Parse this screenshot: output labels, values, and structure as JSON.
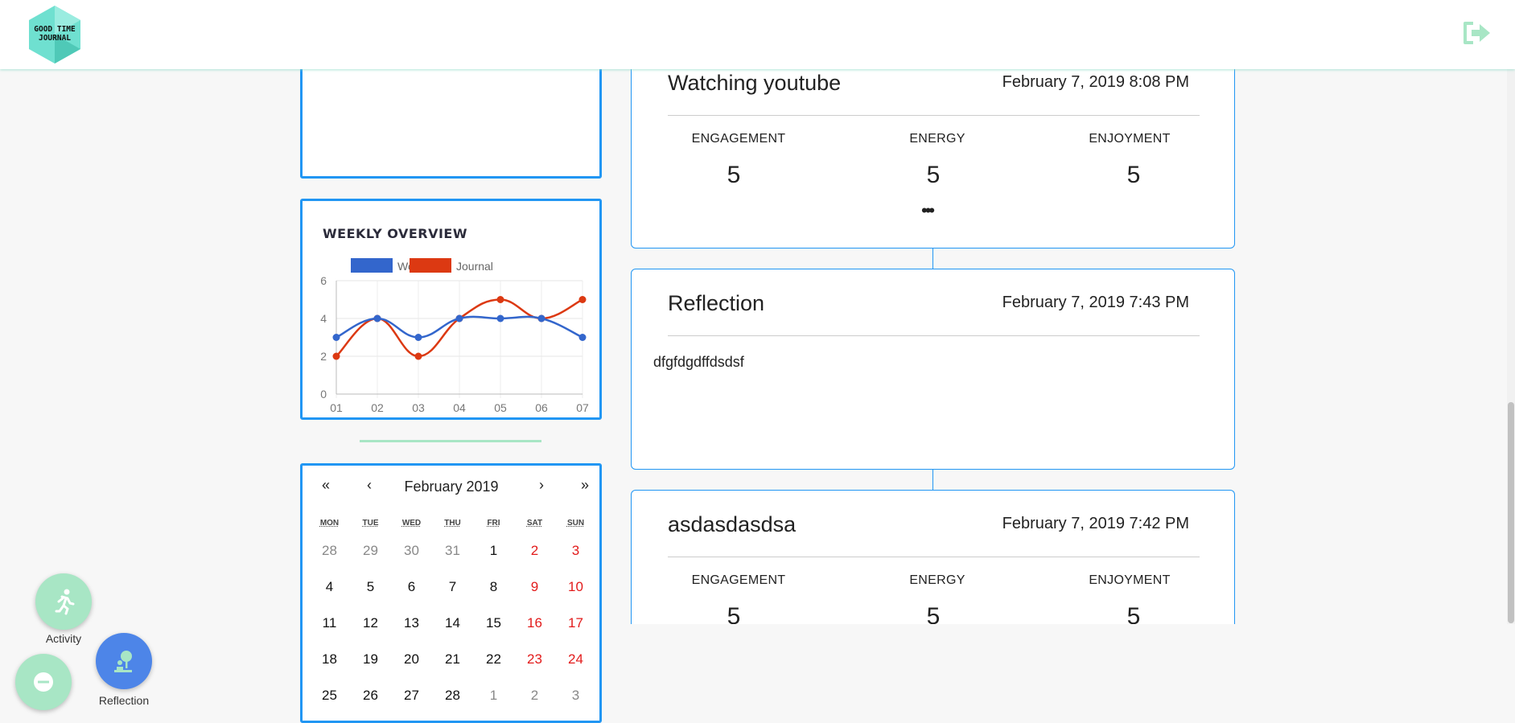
{
  "header": {
    "logo_text_line1": "GOOD TIME",
    "logo_text_line2": "JOURNAL",
    "logout_icon": "sign-out-icon"
  },
  "chart_panel": {
    "chart_data": {
      "type": "line",
      "title": "WEEKLY OVERVIEW",
      "categories": [
        "01",
        "02",
        "03",
        "04",
        "05",
        "06",
        "07"
      ],
      "series": [
        {
          "name": "Workout",
          "values": [
            3,
            4,
            3,
            4,
            4,
            4,
            3
          ],
          "color": "#3366cc"
        },
        {
          "name": "Journal",
          "values": [
            2,
            4,
            2,
            4,
            5,
            4,
            5
          ],
          "color": "#dc3912"
        }
      ],
      "ylim": [
        0,
        6
      ],
      "yticks": [
        0,
        2,
        4,
        6
      ],
      "grid": true,
      "legend": "top"
    }
  },
  "calendar": {
    "prev_year": "«",
    "prev_month": "‹",
    "month_label": "February 2019",
    "next_month": "›",
    "next_year": "»",
    "weekdays": [
      "MON",
      "TUE",
      "WED",
      "THU",
      "FRI",
      "SAT",
      "SUN"
    ],
    "weeks": [
      [
        "28",
        "29",
        "30",
        "31",
        "1",
        "2",
        "3"
      ],
      [
        "4",
        "5",
        "6",
        "7",
        "8",
        "9",
        "10"
      ],
      [
        "11",
        "12",
        "13",
        "14",
        "15",
        "16",
        "17"
      ],
      [
        "18",
        "19",
        "20",
        "21",
        "22",
        "23",
        "24"
      ],
      [
        "25",
        "26",
        "27",
        "28",
        "1",
        "2",
        "3"
      ]
    ]
  },
  "entries": [
    {
      "title": "Watching youtube",
      "date": "February 7, 2019 8:08 PM",
      "engagement_label": "ENGAGEMENT",
      "energy_label": "ENERGY",
      "enjoyment_label": "ENJOYMENT",
      "engagement": "5",
      "energy": "5",
      "enjoyment": "5",
      "more": "•••"
    },
    {
      "title": "Reflection",
      "date": "February 7, 2019 7:43 PM",
      "body": "dfgfdgdffdsdsf"
    },
    {
      "title": "asdasdasdsa",
      "date": "February 7, 2019 7:42 PM",
      "engagement_label": "ENGAGEMENT",
      "energy_label": "ENERGY",
      "enjoyment_label": "ENJOYMENT",
      "engagement": "5",
      "energy": "5",
      "enjoyment": "5"
    }
  ],
  "fabs": {
    "activity_label": "Activity",
    "reflection_label": "Reflection",
    "activity_icon": "running-person-icon",
    "reflection_icon": "meditation-tree-icon",
    "main_icon": "minus-icon"
  },
  "colors": {
    "accent_blue": "#2196f3",
    "mint": "#a8e6c5",
    "fab_blue": "#4d85e8",
    "weekend_red": "#e21b1b"
  }
}
